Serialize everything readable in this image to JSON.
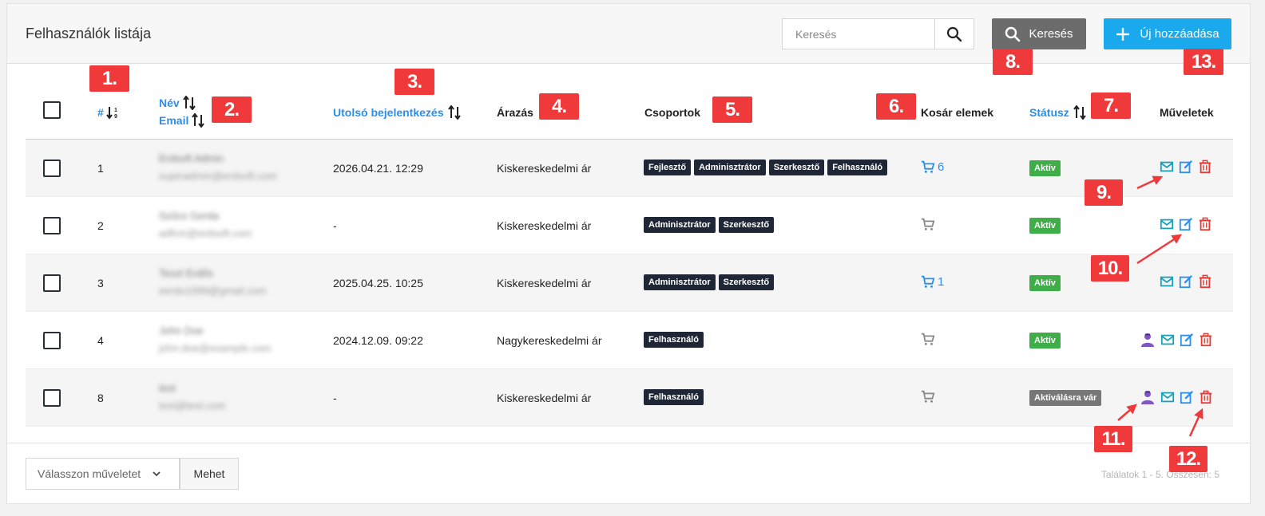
{
  "header": {
    "title": "Felhasználók listája",
    "search_placeholder": "Keresés",
    "search_button": "Keresés",
    "add_button": "Új hozzáadása"
  },
  "columns": {
    "id": "#",
    "name": "Név",
    "email": "Email",
    "last_login": "Utolsó bejelentkezés",
    "pricing": "Árazás",
    "groups": "Csoportok",
    "cart": "Kosár elemek",
    "status": "Státusz",
    "actions": "Műveletek"
  },
  "rows": [
    {
      "id": "1",
      "name": "Erdsoft Admin",
      "email": "supinadmin@erdsoft.com",
      "last_login": "2026.04.21. 12:29",
      "pricing": "Kiskereskedelmi ár",
      "groups": [
        "Fejlesztő",
        "Adminisztrátor",
        "Szerkesztő",
        "Felhasználó"
      ],
      "cart_count": "6",
      "status": "Aktív"
    },
    {
      "id": "2",
      "name": "Szűcs Gerda",
      "email": "adfcm@erdsoft.com",
      "last_login": "-",
      "pricing": "Kiskereskedelmi ár",
      "groups": [
        "Adminisztrátor",
        "Szerkesztő"
      ],
      "cart_count": "",
      "status": "Aktív"
    },
    {
      "id": "3",
      "name": "Teszt Erdős",
      "email": "eerdo1999@gmail.com",
      "last_login": "2025.04.25. 10:25",
      "pricing": "Kiskereskedelmi ár",
      "groups": [
        "Adminisztrátor",
        "Szerkesztő"
      ],
      "cart_count": "1",
      "status": "Aktív"
    },
    {
      "id": "4",
      "name": "John Doe",
      "email": "john.doe@example.com",
      "last_login": "2024.12.09. 09:22",
      "pricing": "Nagykereskedelmi ár",
      "groups": [
        "Felhasználó"
      ],
      "cart_count": "",
      "status": "Aktív"
    },
    {
      "id": "8",
      "name": "test",
      "email": "test@test.com",
      "last_login": "-",
      "pricing": "Kiskereskedelmi ár",
      "groups": [
        "Felhasználó"
      ],
      "cart_count": "",
      "status": "Aktiválásra vár"
    }
  ],
  "footer": {
    "bulk_placeholder": "Válasszon műveletet",
    "bulk_go": "Mehet",
    "results": "Találatok 1 - 5. Összesen: 5"
  },
  "annotations": [
    "1.",
    "2.",
    "3.",
    "4.",
    "5.",
    "6.",
    "7.",
    "8.",
    "9.",
    "10.",
    "11.",
    "12.",
    "13."
  ],
  "colors": {
    "link": "#2b8ee8",
    "annotation": "#f0393b",
    "add_button": "#19a9ec",
    "search_button": "#6c6c6c",
    "active_status": "#3fae49",
    "badge": "#1f2636",
    "delete_icon": "#e53935",
    "mail_icon": "#17a2b8",
    "impersonate_icon": "#7e57c2"
  }
}
